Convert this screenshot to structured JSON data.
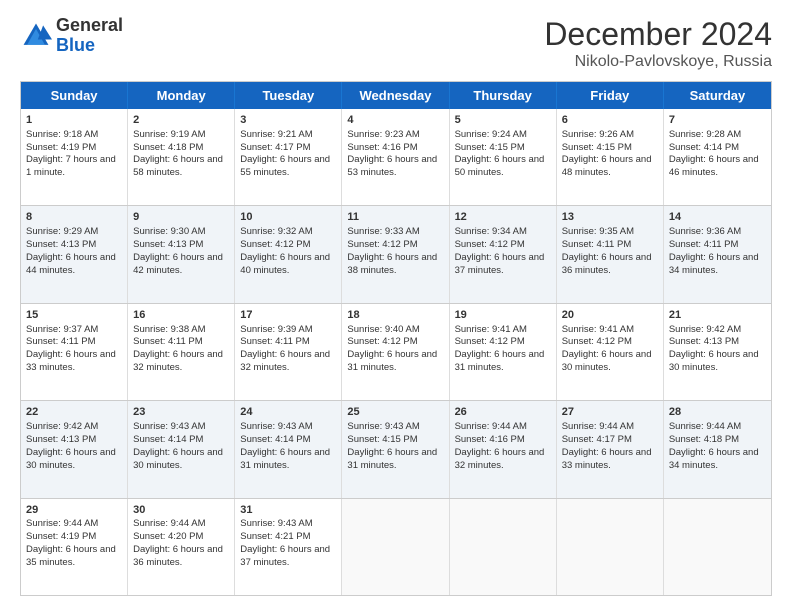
{
  "logo": {
    "general": "General",
    "blue": "Blue"
  },
  "title": {
    "month": "December 2024",
    "location": "Nikolo-Pavlovskoye, Russia"
  },
  "header_days": [
    "Sunday",
    "Monday",
    "Tuesday",
    "Wednesday",
    "Thursday",
    "Friday",
    "Saturday"
  ],
  "weeks": [
    [
      {
        "day": "1",
        "sunrise": "Sunrise: 9:18 AM",
        "sunset": "Sunset: 4:19 PM",
        "daylight": "Daylight: 7 hours and 1 minute."
      },
      {
        "day": "2",
        "sunrise": "Sunrise: 9:19 AM",
        "sunset": "Sunset: 4:18 PM",
        "daylight": "Daylight: 6 hours and 58 minutes."
      },
      {
        "day": "3",
        "sunrise": "Sunrise: 9:21 AM",
        "sunset": "Sunset: 4:17 PM",
        "daylight": "Daylight: 6 hours and 55 minutes."
      },
      {
        "day": "4",
        "sunrise": "Sunrise: 9:23 AM",
        "sunset": "Sunset: 4:16 PM",
        "daylight": "Daylight: 6 hours and 53 minutes."
      },
      {
        "day": "5",
        "sunrise": "Sunrise: 9:24 AM",
        "sunset": "Sunset: 4:15 PM",
        "daylight": "Daylight: 6 hours and 50 minutes."
      },
      {
        "day": "6",
        "sunrise": "Sunrise: 9:26 AM",
        "sunset": "Sunset: 4:15 PM",
        "daylight": "Daylight: 6 hours and 48 minutes."
      },
      {
        "day": "7",
        "sunrise": "Sunrise: 9:28 AM",
        "sunset": "Sunset: 4:14 PM",
        "daylight": "Daylight: 6 hours and 46 minutes."
      }
    ],
    [
      {
        "day": "8",
        "sunrise": "Sunrise: 9:29 AM",
        "sunset": "Sunset: 4:13 PM",
        "daylight": "Daylight: 6 hours and 44 minutes."
      },
      {
        "day": "9",
        "sunrise": "Sunrise: 9:30 AM",
        "sunset": "Sunset: 4:13 PM",
        "daylight": "Daylight: 6 hours and 42 minutes."
      },
      {
        "day": "10",
        "sunrise": "Sunrise: 9:32 AM",
        "sunset": "Sunset: 4:12 PM",
        "daylight": "Daylight: 6 hours and 40 minutes."
      },
      {
        "day": "11",
        "sunrise": "Sunrise: 9:33 AM",
        "sunset": "Sunset: 4:12 PM",
        "daylight": "Daylight: 6 hours and 38 minutes."
      },
      {
        "day": "12",
        "sunrise": "Sunrise: 9:34 AM",
        "sunset": "Sunset: 4:12 PM",
        "daylight": "Daylight: 6 hours and 37 minutes."
      },
      {
        "day": "13",
        "sunrise": "Sunrise: 9:35 AM",
        "sunset": "Sunset: 4:11 PM",
        "daylight": "Daylight: 6 hours and 36 minutes."
      },
      {
        "day": "14",
        "sunrise": "Sunrise: 9:36 AM",
        "sunset": "Sunset: 4:11 PM",
        "daylight": "Daylight: 6 hours and 34 minutes."
      }
    ],
    [
      {
        "day": "15",
        "sunrise": "Sunrise: 9:37 AM",
        "sunset": "Sunset: 4:11 PM",
        "daylight": "Daylight: 6 hours and 33 minutes."
      },
      {
        "day": "16",
        "sunrise": "Sunrise: 9:38 AM",
        "sunset": "Sunset: 4:11 PM",
        "daylight": "Daylight: 6 hours and 32 minutes."
      },
      {
        "day": "17",
        "sunrise": "Sunrise: 9:39 AM",
        "sunset": "Sunset: 4:11 PM",
        "daylight": "Daylight: 6 hours and 32 minutes."
      },
      {
        "day": "18",
        "sunrise": "Sunrise: 9:40 AM",
        "sunset": "Sunset: 4:12 PM",
        "daylight": "Daylight: 6 hours and 31 minutes."
      },
      {
        "day": "19",
        "sunrise": "Sunrise: 9:41 AM",
        "sunset": "Sunset: 4:12 PM",
        "daylight": "Daylight: 6 hours and 31 minutes."
      },
      {
        "day": "20",
        "sunrise": "Sunrise: 9:41 AM",
        "sunset": "Sunset: 4:12 PM",
        "daylight": "Daylight: 6 hours and 30 minutes."
      },
      {
        "day": "21",
        "sunrise": "Sunrise: 9:42 AM",
        "sunset": "Sunset: 4:13 PM",
        "daylight": "Daylight: 6 hours and 30 minutes."
      }
    ],
    [
      {
        "day": "22",
        "sunrise": "Sunrise: 9:42 AM",
        "sunset": "Sunset: 4:13 PM",
        "daylight": "Daylight: 6 hours and 30 minutes."
      },
      {
        "day": "23",
        "sunrise": "Sunrise: 9:43 AM",
        "sunset": "Sunset: 4:14 PM",
        "daylight": "Daylight: 6 hours and 30 minutes."
      },
      {
        "day": "24",
        "sunrise": "Sunrise: 9:43 AM",
        "sunset": "Sunset: 4:14 PM",
        "daylight": "Daylight: 6 hours and 31 minutes."
      },
      {
        "day": "25",
        "sunrise": "Sunrise: 9:43 AM",
        "sunset": "Sunset: 4:15 PM",
        "daylight": "Daylight: 6 hours and 31 minutes."
      },
      {
        "day": "26",
        "sunrise": "Sunrise: 9:44 AM",
        "sunset": "Sunset: 4:16 PM",
        "daylight": "Daylight: 6 hours and 32 minutes."
      },
      {
        "day": "27",
        "sunrise": "Sunrise: 9:44 AM",
        "sunset": "Sunset: 4:17 PM",
        "daylight": "Daylight: 6 hours and 33 minutes."
      },
      {
        "day": "28",
        "sunrise": "Sunrise: 9:44 AM",
        "sunset": "Sunset: 4:18 PM",
        "daylight": "Daylight: 6 hours and 34 minutes."
      }
    ],
    [
      {
        "day": "29",
        "sunrise": "Sunrise: 9:44 AM",
        "sunset": "Sunset: 4:19 PM",
        "daylight": "Daylight: 6 hours and 35 minutes."
      },
      {
        "day": "30",
        "sunrise": "Sunrise: 9:44 AM",
        "sunset": "Sunset: 4:20 PM",
        "daylight": "Daylight: 6 hours and 36 minutes."
      },
      {
        "day": "31",
        "sunrise": "Sunrise: 9:43 AM",
        "sunset": "Sunset: 4:21 PM",
        "daylight": "Daylight: 6 hours and 37 minutes."
      },
      null,
      null,
      null,
      null
    ]
  ]
}
